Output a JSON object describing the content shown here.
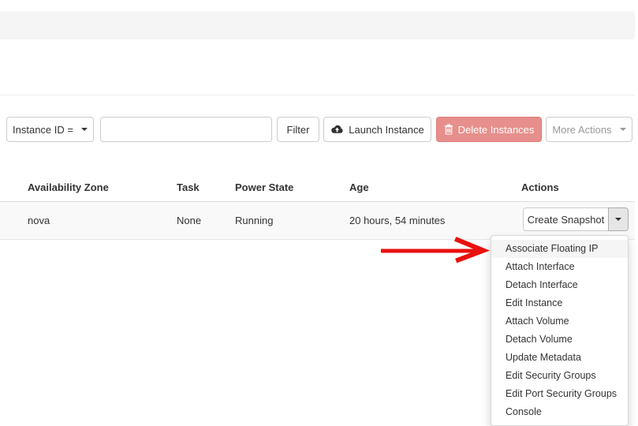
{
  "toolbar": {
    "filter_field_button": "Instance ID =",
    "filter_input_value": "",
    "filter_input_placeholder": "",
    "filter_button": "Filter",
    "launch_instance_button": "Launch Instance",
    "delete_instances_button": "Delete Instances",
    "more_actions_button": "More Actions"
  },
  "table": {
    "columns": [
      "Availability Zone",
      "Task",
      "Power State",
      "Age",
      "Actions"
    ],
    "rows": [
      {
        "availability_zone": "nova",
        "task": "None",
        "power_state": "Running",
        "age": "20 hours, 54 minutes",
        "primary_action": "Create Snapshot"
      }
    ]
  },
  "actions_menu": {
    "highlighted_item": "Associate Floating IP",
    "items": [
      "Associate Floating IP",
      "Attach Interface",
      "Detach Interface",
      "Edit Instance",
      "Attach Volume",
      "Detach Volume",
      "Update Metadata",
      "Edit Security Groups",
      "Edit Port Security Groups",
      "Console"
    ]
  },
  "annotation": {
    "type": "red-arrow",
    "points_to": "Associate Floating IP",
    "color": "#e8110d"
  },
  "colors": {
    "danger_button_bg": "#e68f8c",
    "danger_button_border": "#e17a77",
    "panel_bg": "#f5f5f5",
    "row_bg": "#f9f9f9",
    "menu_hover_bg": "#f5f5f5",
    "border": "#cccccc",
    "text": "#333333",
    "muted_text": "#999999"
  }
}
